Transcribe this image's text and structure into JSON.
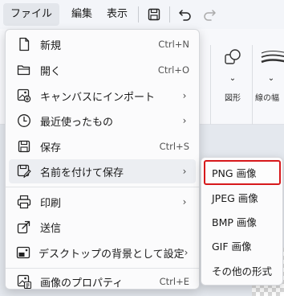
{
  "menubar": {
    "file": "ファイル",
    "edit": "編集",
    "view": "表示",
    "save_icon": "save-icon",
    "undo_icon": "undo-icon",
    "redo_icon": "redo-icon"
  },
  "ribbon": {
    "shapes_label": "図形",
    "brush_label": "線の幅"
  },
  "file_menu": {
    "items": [
      {
        "label": "新規",
        "shortcut": "Ctrl+N",
        "icon": "new-file-icon"
      },
      {
        "label": "開く",
        "shortcut": "Ctrl+O",
        "icon": "folder-icon"
      },
      {
        "label": "キャンバスにインポート",
        "shortcut": "",
        "icon": "image-import-icon",
        "submenu": true
      },
      {
        "label": "最近使ったもの",
        "shortcut": "",
        "icon": "clock-icon",
        "submenu": true
      },
      {
        "label": "保存",
        "shortcut": "Ctrl+S",
        "icon": "save-icon"
      },
      {
        "label": "名前を付けて保存",
        "shortcut": "",
        "icon": "save-as-icon",
        "submenu": true
      },
      {
        "label": "印刷",
        "shortcut": "",
        "icon": "printer-icon",
        "submenu": true
      },
      {
        "label": "送信",
        "shortcut": "",
        "icon": "share-icon"
      },
      {
        "label": "デスクトップの背景として設定",
        "shortcut": "",
        "icon": "desktop-background-icon",
        "submenu": true
      },
      {
        "label": "画像のプロパティ",
        "shortcut": "Ctrl+E",
        "icon": "image-properties-icon"
      }
    ]
  },
  "save_as_submenu": {
    "items": [
      {
        "label": "PNG 画像",
        "selected": true
      },
      {
        "label": "JPEG 画像"
      },
      {
        "label": "BMP 画像"
      },
      {
        "label": "GIF 画像"
      },
      {
        "label": "その他の形式"
      }
    ]
  },
  "colors": {
    "selection_outline": "#d7191c",
    "hover_background": "#eceef2"
  }
}
